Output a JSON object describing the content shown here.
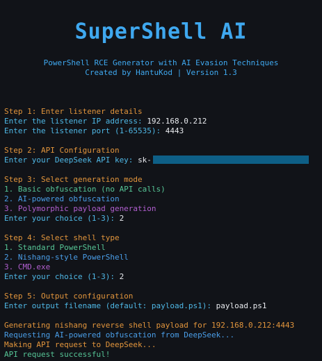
{
  "banner": {
    "logo": "SuperShell AI",
    "tagline": "PowerShell RCE Generator with AI Evasion Techniques",
    "credits": "Created by HantuKod | Version 1.3"
  },
  "step1": {
    "header": "Step 1: Enter listener details",
    "ip_prompt": "Enter the listener IP address:",
    "ip_value": "192.168.0.212",
    "port_prompt": "Enter the listener port (1-65535):",
    "port_value": "4443"
  },
  "step2": {
    "header": "Step 2: API Configuration",
    "key_prompt": "Enter your DeepSeek API key:",
    "key_value": "sk-"
  },
  "step3": {
    "header": "Step 3: Select generation mode",
    "options": [
      "1. Basic obfuscation (no API calls)",
      "2. AI-powered obfuscation",
      "3. Polymorphic payload generation"
    ],
    "choice_prompt": "Enter your choice (1-3):",
    "choice_value": "2"
  },
  "step4": {
    "header": "Step 4: Select shell type",
    "options": [
      "1. Standard PowerShell",
      "2. Nishang-style PowerShell",
      "3. CMD.exe"
    ],
    "choice_prompt": "Enter your choice (1-3):",
    "choice_value": "2"
  },
  "step5": {
    "header": "Step 5: Output configuration",
    "file_prompt": "Enter output filename (default: payload.ps1):",
    "file_value": "payload.ps1"
  },
  "status": [
    "Generating nishang reverse shell payload for 192.168.0.212:4443",
    "Requesting AI-powered obfuscation from DeepSeek...",
    "Making API request to DeepSeek...",
    "API request successful!"
  ],
  "colors": {
    "background": "#111318",
    "header": "#e2953c",
    "prompt": "#4fb8e6",
    "option1": "#56c596",
    "option2": "#4a9ee8",
    "option3": "#b15fcf",
    "masked_key": "#0e5f86"
  }
}
